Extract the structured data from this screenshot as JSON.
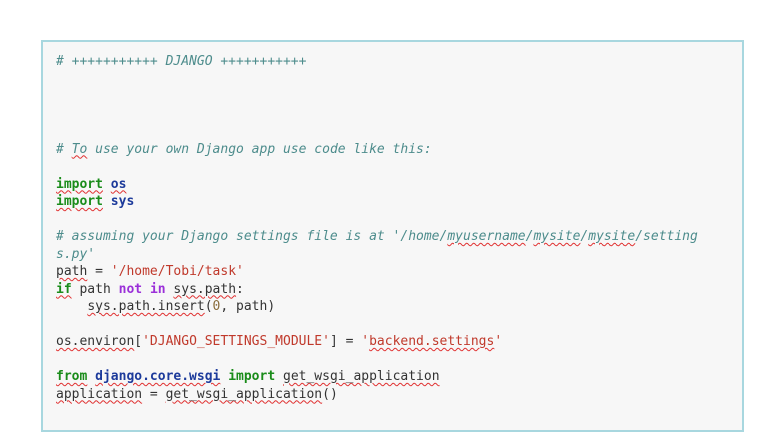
{
  "editor": {
    "lines": {
      "l1": "# +++++++++++ DJANGO +++++++++++",
      "l6_a": "# ",
      "l6_b": "To",
      "l6_c": " use your own Django app use code like this:",
      "l8_kw": "import",
      "l8_sp": " ",
      "l8_mod": "os",
      "l9_kw": "import",
      "l9_sp": " ",
      "l9_mod": "sys",
      "l11_a": "# assuming your Django settings file is at '/home/",
      "l11_b": "myusername",
      "l11_c": "/",
      "l11_d": "mysite",
      "l11_e": "/",
      "l11_f": "mysite",
      "l11_g": "/setting",
      "l12": "s.py'",
      "l13_a": "path",
      "l13_b": " = ",
      "l13_c": "'/home/Tobi/task'",
      "l14_a": "if",
      "l14_b": " path ",
      "l14_c": "not",
      "l14_d": " ",
      "l14_e": "in",
      "l14_f": " ",
      "l14_g": "sys.path",
      "l14_h": ":",
      "l15_a": "    ",
      "l15_b": "sys.path.insert",
      "l15_c": "(",
      "l15_d": "0",
      "l15_e": ", path)",
      "l17_a": "os.environ",
      "l17_b": "[",
      "l17_c": "'DJANGO_SETTINGS_MODULE'",
      "l17_d": "] = ",
      "l17_e": "'",
      "l17_f": "backend.settings",
      "l17_g": "'",
      "l19_a": "from",
      "l19_b": " ",
      "l19_c": "django.core.wsgi",
      "l19_d": " ",
      "l19_e": "import",
      "l19_f": " ",
      "l19_g": "get_wsgi_application",
      "l20_a": "application",
      "l20_b": " = ",
      "l20_c": "get_wsgi_application",
      "l20_d": "()"
    }
  },
  "colors": {
    "border": "#a8d7df",
    "background": "#f7f7f7",
    "comment": "#4d8c8c",
    "keyword": "#1a8c1a",
    "keyword_operator": "#9b30d9",
    "string": "#c0392b",
    "spellcheck": "#e03030"
  }
}
